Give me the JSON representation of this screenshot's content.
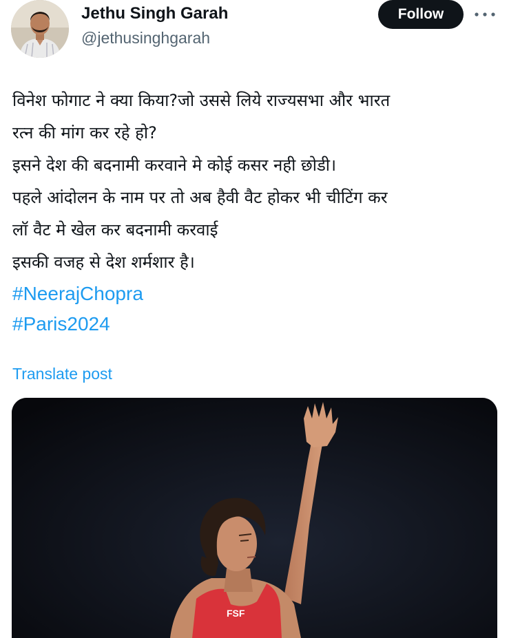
{
  "author": {
    "name": "Jethu Singh Garah",
    "handle": "@jethusinghgarah",
    "avatar_icon": "profile-photo"
  },
  "actions": {
    "follow_label": "Follow",
    "more_icon": "more-horizontal-icon"
  },
  "post": {
    "lines": [
      "विनेश फोगाट ने क्या किया?जो उससे लिये राज्यसभा और भारत",
      "रत्न की मांग कर रहे हो?",
      "इसने देश की बदनामी करवाने मे कोई कसर नही छोडी।",
      "पहले आंदोलन के नाम पर तो अब हैवी वैट होकर भी चीटिंग कर",
      "लॉ वैट मे खेल कर बदनामी करवाई",
      "इसकी वजह से देश शर्मशार है।"
    ],
    "hashtags": [
      "#NeerajChopra",
      "#Paris2024"
    ],
    "translate_label": "Translate post"
  },
  "media": {
    "jersey_text": "FSF",
    "colors": {
      "background": "#0b0d12",
      "jersey": "#d9333a",
      "skin": "#c98d6c",
      "hair": "#2a1c14"
    }
  },
  "colors": {
    "link": "#1d9bf0",
    "text": "#0f1419",
    "secondary": "#536471",
    "button": "#0f1419"
  }
}
